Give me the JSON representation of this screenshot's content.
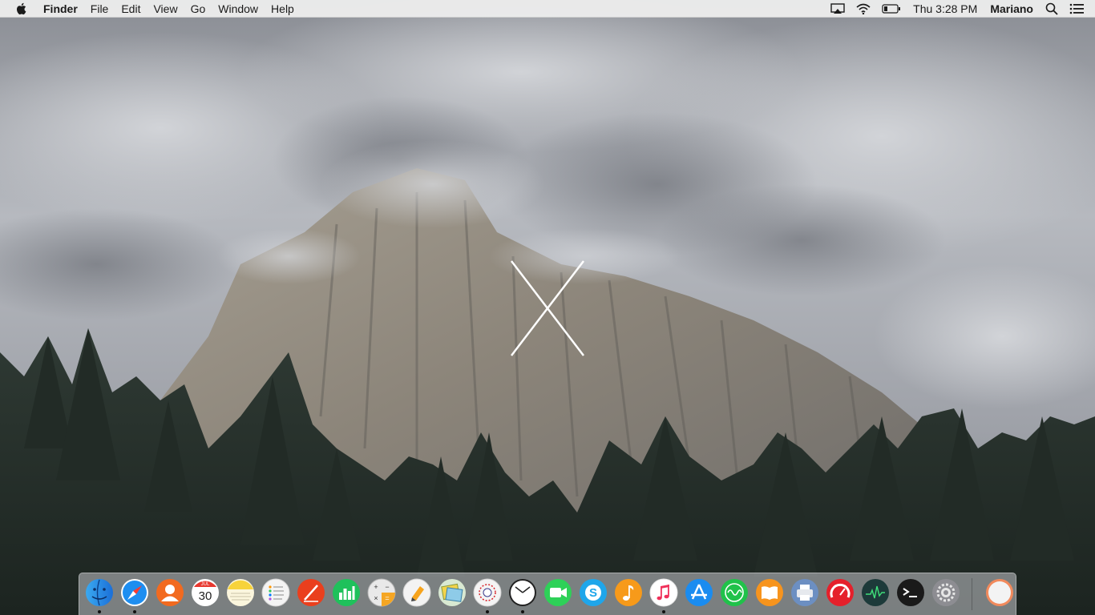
{
  "menubar": {
    "apple_icon": "apple-logo-icon",
    "app_name": "Finder",
    "menus": [
      "File",
      "Edit",
      "View",
      "Go",
      "Window",
      "Help"
    ],
    "status_icons": [
      "airplay-icon",
      "wifi-icon",
      "battery-icon"
    ],
    "clock": "Thu 3:28 PM",
    "user": "Mariano",
    "right_icons": [
      "spotlight-search-icon",
      "notification-center-icon"
    ]
  },
  "dock": {
    "calendar_month": "JUL",
    "calendar_day": "30",
    "apps": [
      {
        "name": "Finder",
        "icon": "finder-icon",
        "running": true
      },
      {
        "name": "Safari",
        "icon": "safari-icon",
        "running": true
      },
      {
        "name": "Contacts",
        "icon": "contacts-icon",
        "running": false
      },
      {
        "name": "Calendar",
        "icon": "calendar-icon",
        "running": false
      },
      {
        "name": "Notes",
        "icon": "notes-icon",
        "running": false
      },
      {
        "name": "Reminders",
        "icon": "reminders-icon",
        "running": false
      },
      {
        "name": "Sketch",
        "icon": "pen-app-icon",
        "running": false
      },
      {
        "name": "Numbers",
        "icon": "numbers-chart-icon",
        "running": false
      },
      {
        "name": "Calculator",
        "icon": "calculator-icon",
        "running": false
      },
      {
        "name": "Pages",
        "icon": "pages-icon",
        "running": false
      },
      {
        "name": "Preview",
        "icon": "preview-photos-icon",
        "running": false
      },
      {
        "name": "Photo Booth",
        "icon": "photo-booth-icon",
        "running": true
      },
      {
        "name": "Clock",
        "icon": "clock-icon",
        "running": true
      },
      {
        "name": "FaceTime",
        "icon": "facetime-icon",
        "running": false
      },
      {
        "name": "Skype",
        "icon": "skype-icon",
        "running": false
      },
      {
        "name": "Music Player",
        "icon": "music-note-icon",
        "running": false
      },
      {
        "name": "iTunes",
        "icon": "itunes-icon",
        "running": true
      },
      {
        "name": "App Store",
        "icon": "app-store-icon",
        "running": false
      },
      {
        "name": "Activity",
        "icon": "waveform-icon",
        "running": false
      },
      {
        "name": "iBooks",
        "icon": "ibooks-icon",
        "running": false
      },
      {
        "name": "Printer",
        "icon": "printer-icon",
        "running": false
      },
      {
        "name": "Speedtest",
        "icon": "speedometer-icon",
        "running": false
      },
      {
        "name": "Activity Monitor",
        "icon": "activity-monitor-icon",
        "running": false
      },
      {
        "name": "Terminal",
        "icon": "terminal-icon",
        "running": false
      },
      {
        "name": "System Preferences",
        "icon": "system-preferences-gear-icon",
        "running": false
      }
    ],
    "trash": {
      "name": "Trash",
      "icon": "trash-circle-icon",
      "running": false
    }
  },
  "colors": {
    "menubar_bg": "#ececec",
    "dock_bg": "#c8cad0",
    "wallpaper_sky": "#b9bcc3",
    "wallpaper_rock": "#8a8378",
    "wallpaper_trees": "#26302b"
  },
  "wallpaper": {
    "name": "El Capitan",
    "logo_icon": "os-x-logo-icon"
  }
}
